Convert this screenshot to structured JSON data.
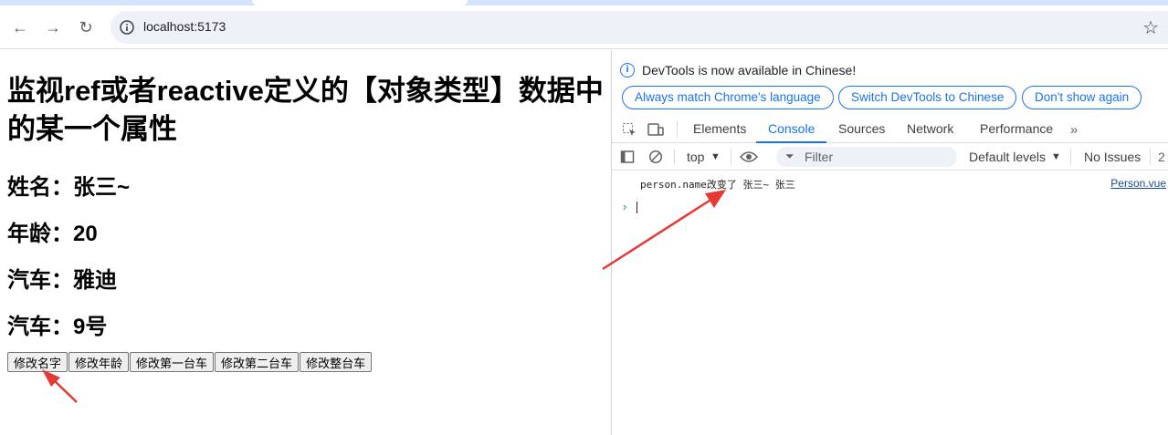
{
  "browser": {
    "url": "localhost:5173"
  },
  "page": {
    "title": "监视ref或者reactive定义的【对象类型】数据中的某一个属性",
    "fields": [
      "姓名：张三~",
      "年龄：20",
      "汽车：雅迪",
      "汽车：9号"
    ],
    "buttons": [
      "修改名字",
      "修改年龄",
      "修改第一台车",
      "修改第二台车",
      "修改整台车"
    ]
  },
  "devtools": {
    "infobar_text": "DevTools is now available in Chinese!",
    "infobar_buttons": [
      "Always match Chrome's language",
      "Switch DevTools to Chinese",
      "Don't show again"
    ],
    "tabs": [
      "Elements",
      "Console",
      "Sources",
      "Network",
      "Performance"
    ],
    "active_tab": "Console",
    "context": "top",
    "filter_placeholder": "Filter",
    "levels": "Default levels",
    "issues": "No Issues",
    "issues_count": "2",
    "log_message": "person.name改变了 张三~ 张三",
    "log_source": "Person.vue"
  },
  "colors": {
    "accent": "#1a73e8",
    "annotation_arrow": "#e53935"
  }
}
